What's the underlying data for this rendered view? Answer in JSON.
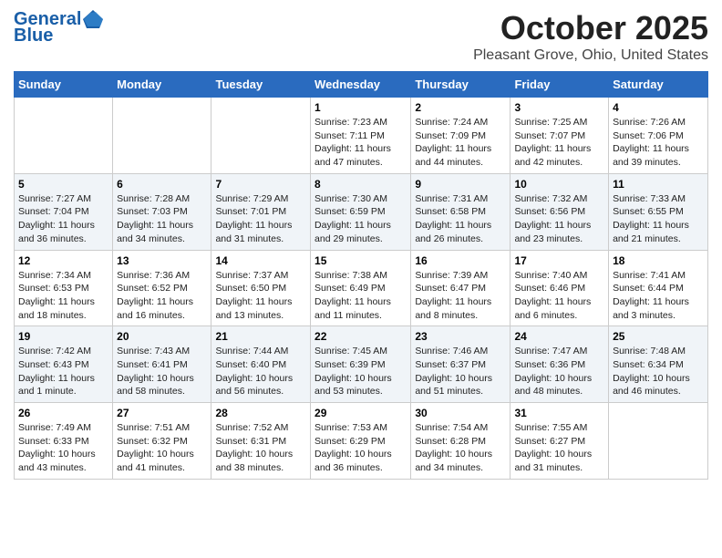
{
  "logo": {
    "line1": "General",
    "line2": "Blue"
  },
  "header": {
    "month": "October 2025",
    "location": "Pleasant Grove, Ohio, United States"
  },
  "days_of_week": [
    "Sunday",
    "Monday",
    "Tuesday",
    "Wednesday",
    "Thursday",
    "Friday",
    "Saturday"
  ],
  "weeks": [
    [
      {
        "day": "",
        "info": ""
      },
      {
        "day": "",
        "info": ""
      },
      {
        "day": "",
        "info": ""
      },
      {
        "day": "1",
        "info": "Sunrise: 7:23 AM\nSunset: 7:11 PM\nDaylight: 11 hours and 47 minutes."
      },
      {
        "day": "2",
        "info": "Sunrise: 7:24 AM\nSunset: 7:09 PM\nDaylight: 11 hours and 44 minutes."
      },
      {
        "day": "3",
        "info": "Sunrise: 7:25 AM\nSunset: 7:07 PM\nDaylight: 11 hours and 42 minutes."
      },
      {
        "day": "4",
        "info": "Sunrise: 7:26 AM\nSunset: 7:06 PM\nDaylight: 11 hours and 39 minutes."
      }
    ],
    [
      {
        "day": "5",
        "info": "Sunrise: 7:27 AM\nSunset: 7:04 PM\nDaylight: 11 hours and 36 minutes."
      },
      {
        "day": "6",
        "info": "Sunrise: 7:28 AM\nSunset: 7:03 PM\nDaylight: 11 hours and 34 minutes."
      },
      {
        "day": "7",
        "info": "Sunrise: 7:29 AM\nSunset: 7:01 PM\nDaylight: 11 hours and 31 minutes."
      },
      {
        "day": "8",
        "info": "Sunrise: 7:30 AM\nSunset: 6:59 PM\nDaylight: 11 hours and 29 minutes."
      },
      {
        "day": "9",
        "info": "Sunrise: 7:31 AM\nSunset: 6:58 PM\nDaylight: 11 hours and 26 minutes."
      },
      {
        "day": "10",
        "info": "Sunrise: 7:32 AM\nSunset: 6:56 PM\nDaylight: 11 hours and 23 minutes."
      },
      {
        "day": "11",
        "info": "Sunrise: 7:33 AM\nSunset: 6:55 PM\nDaylight: 11 hours and 21 minutes."
      }
    ],
    [
      {
        "day": "12",
        "info": "Sunrise: 7:34 AM\nSunset: 6:53 PM\nDaylight: 11 hours and 18 minutes."
      },
      {
        "day": "13",
        "info": "Sunrise: 7:36 AM\nSunset: 6:52 PM\nDaylight: 11 hours and 16 minutes."
      },
      {
        "day": "14",
        "info": "Sunrise: 7:37 AM\nSunset: 6:50 PM\nDaylight: 11 hours and 13 minutes."
      },
      {
        "day": "15",
        "info": "Sunrise: 7:38 AM\nSunset: 6:49 PM\nDaylight: 11 hours and 11 minutes."
      },
      {
        "day": "16",
        "info": "Sunrise: 7:39 AM\nSunset: 6:47 PM\nDaylight: 11 hours and 8 minutes."
      },
      {
        "day": "17",
        "info": "Sunrise: 7:40 AM\nSunset: 6:46 PM\nDaylight: 11 hours and 6 minutes."
      },
      {
        "day": "18",
        "info": "Sunrise: 7:41 AM\nSunset: 6:44 PM\nDaylight: 11 hours and 3 minutes."
      }
    ],
    [
      {
        "day": "19",
        "info": "Sunrise: 7:42 AM\nSunset: 6:43 PM\nDaylight: 11 hours and 1 minute."
      },
      {
        "day": "20",
        "info": "Sunrise: 7:43 AM\nSunset: 6:41 PM\nDaylight: 10 hours and 58 minutes."
      },
      {
        "day": "21",
        "info": "Sunrise: 7:44 AM\nSunset: 6:40 PM\nDaylight: 10 hours and 56 minutes."
      },
      {
        "day": "22",
        "info": "Sunrise: 7:45 AM\nSunset: 6:39 PM\nDaylight: 10 hours and 53 minutes."
      },
      {
        "day": "23",
        "info": "Sunrise: 7:46 AM\nSunset: 6:37 PM\nDaylight: 10 hours and 51 minutes."
      },
      {
        "day": "24",
        "info": "Sunrise: 7:47 AM\nSunset: 6:36 PM\nDaylight: 10 hours and 48 minutes."
      },
      {
        "day": "25",
        "info": "Sunrise: 7:48 AM\nSunset: 6:34 PM\nDaylight: 10 hours and 46 minutes."
      }
    ],
    [
      {
        "day": "26",
        "info": "Sunrise: 7:49 AM\nSunset: 6:33 PM\nDaylight: 10 hours and 43 minutes."
      },
      {
        "day": "27",
        "info": "Sunrise: 7:51 AM\nSunset: 6:32 PM\nDaylight: 10 hours and 41 minutes."
      },
      {
        "day": "28",
        "info": "Sunrise: 7:52 AM\nSunset: 6:31 PM\nDaylight: 10 hours and 38 minutes."
      },
      {
        "day": "29",
        "info": "Sunrise: 7:53 AM\nSunset: 6:29 PM\nDaylight: 10 hours and 36 minutes."
      },
      {
        "day": "30",
        "info": "Sunrise: 7:54 AM\nSunset: 6:28 PM\nDaylight: 10 hours and 34 minutes."
      },
      {
        "day": "31",
        "info": "Sunrise: 7:55 AM\nSunset: 6:27 PM\nDaylight: 10 hours and 31 minutes."
      },
      {
        "day": "",
        "info": ""
      }
    ]
  ]
}
